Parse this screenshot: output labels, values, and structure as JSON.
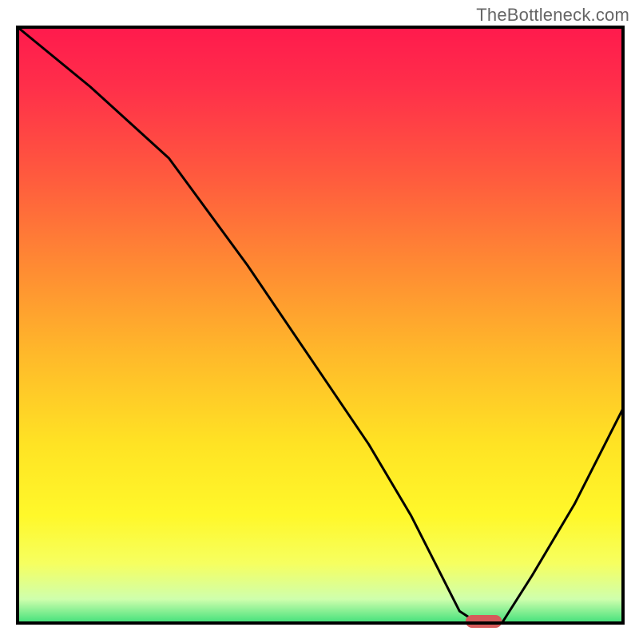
{
  "watermark": "TheBottleneck.com",
  "chart_data": {
    "type": "line",
    "title": "",
    "xlabel": "",
    "ylabel": "",
    "xlim": [
      0,
      100
    ],
    "ylim": [
      0,
      100
    ],
    "grid": false,
    "series": [
      {
        "name": "bottleneck-curve",
        "x": [
          0,
          12,
          25,
          38,
          50,
          58,
          65,
          70,
          73,
          76,
          80,
          85,
          92,
          100
        ],
        "y": [
          100,
          90,
          78,
          60,
          42,
          30,
          18,
          8,
          2,
          0,
          0,
          8,
          20,
          36
        ]
      }
    ],
    "marker": {
      "name": "optimal-range",
      "x_start": 74,
      "x_end": 80,
      "y": 0
    },
    "gradient_stops": [
      {
        "offset": 0.0,
        "color": "#ff1a4d"
      },
      {
        "offset": 0.1,
        "color": "#ff2f4a"
      },
      {
        "offset": 0.25,
        "color": "#ff5a3e"
      },
      {
        "offset": 0.4,
        "color": "#ff8a33"
      },
      {
        "offset": 0.55,
        "color": "#ffb92a"
      },
      {
        "offset": 0.7,
        "color": "#ffe324"
      },
      {
        "offset": 0.82,
        "color": "#fff82a"
      },
      {
        "offset": 0.9,
        "color": "#f6ff60"
      },
      {
        "offset": 0.96,
        "color": "#cfffad"
      },
      {
        "offset": 1.0,
        "color": "#41e07a"
      }
    ],
    "frame_color": "#000000",
    "curve_color": "#000000",
    "marker_color": "#d55a5a"
  }
}
